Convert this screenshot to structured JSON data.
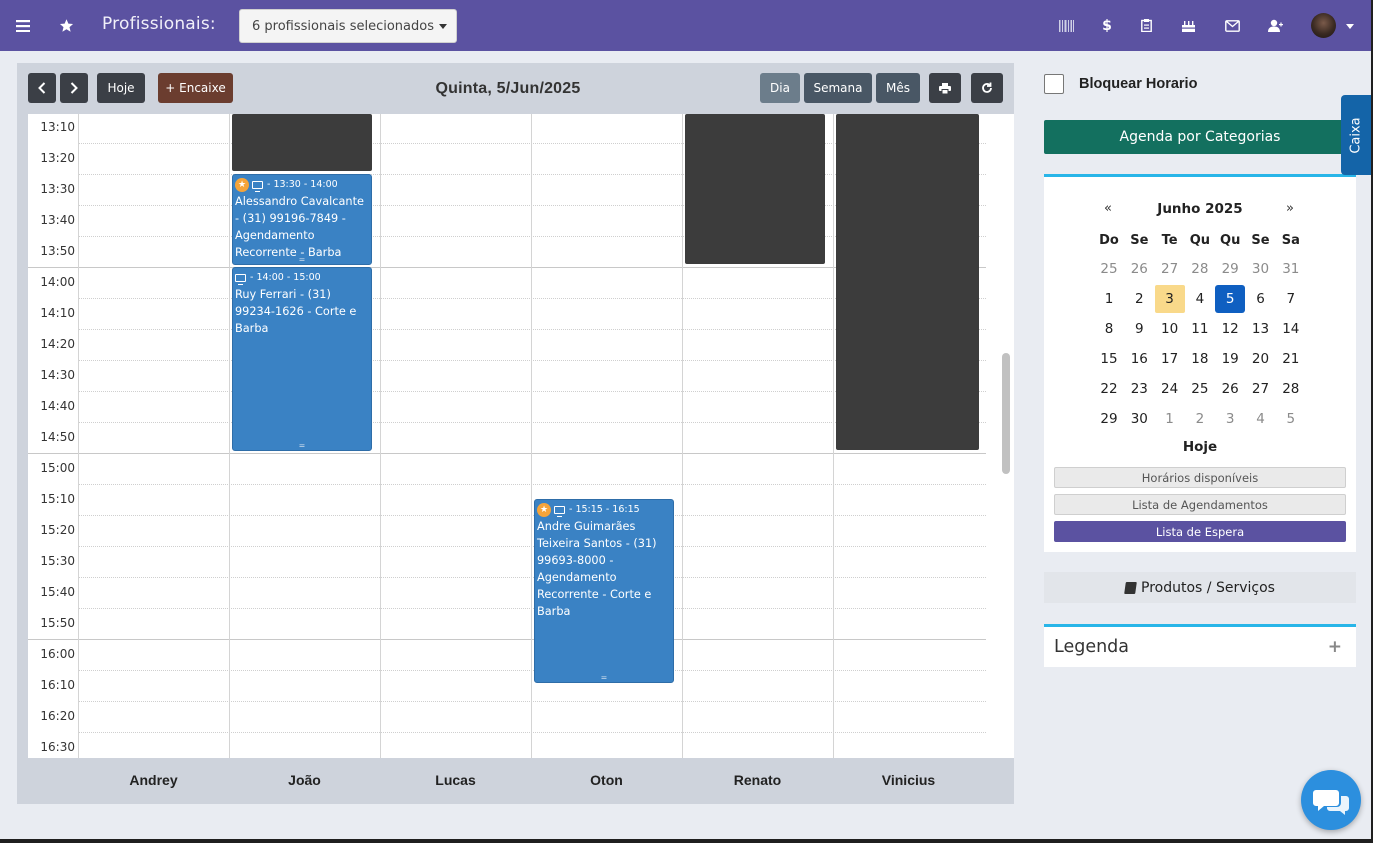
{
  "topbar": {
    "menu_icon": "hamburger-icon",
    "fav_icon": "star-icon",
    "prof_label": "Profissionais:",
    "prof_select": "6 profissionais selecionados",
    "icons": [
      "barcode-icon",
      "dollar-icon",
      "clipboard-icon",
      "cake-icon",
      "mail-icon",
      "user-plus-icon"
    ],
    "bg_color": "#5b52a1"
  },
  "toolbar": {
    "prev_icon": "chevron-left-icon",
    "next_icon": "chevron-right-icon",
    "hoje": "Hoje",
    "encaixe": "+ Encaixe",
    "date_title": "Quinta, 5/Jun/2025",
    "view_day": "Dia",
    "view_week": "Semana",
    "view_month": "Mês",
    "print_icon": "print-icon",
    "refresh_icon": "refresh-icon"
  },
  "times": [
    "13:10",
    "13:20",
    "13:30",
    "13:40",
    "13:50",
    "14:00",
    "14:10",
    "14:20",
    "14:30",
    "14:40",
    "14:50",
    "15:00",
    "15:10",
    "15:20",
    "15:30",
    "15:40",
    "15:50",
    "16:00",
    "16:10",
    "16:20",
    "16:30"
  ],
  "professionals": [
    "Andrey",
    "João",
    "Lucas",
    "Oton",
    "Renato",
    "Vinicius"
  ],
  "events": [
    {
      "time": "- 13:30 - 14:00",
      "text": "Alessandro Cavalcante - (31) 99196-7849 - Agendamento Recorrente - Barba",
      "star": true,
      "color": "#3a82c4"
    },
    {
      "time": "- 14:00 - 15:00",
      "text": "Ruy Ferrari - (31) 99234-1626 - Corte e Barba",
      "star": false,
      "color": "#3a82c4"
    },
    {
      "time": "- 15:15 - 16:15",
      "text": "Andre Guimarães Teixeira Santos - (31) 99693-8000 - Agendamento Recorrente - Corte e Barba",
      "star": true,
      "color": "#3a82c4"
    }
  ],
  "sidebar": {
    "bloquear": "Bloquear Horario",
    "agenda_categorias": "Agenda por Categorias",
    "caixa": "Caixa",
    "calendar": {
      "prev": "«",
      "next": "»",
      "title": "Junho 2025",
      "weekdays": [
        "Do",
        "Se",
        "Te",
        "Qu",
        "Qu",
        "Se",
        "Sa"
      ],
      "weeks": [
        [
          "25",
          "26",
          "27",
          "28",
          "29",
          "30",
          "31"
        ],
        [
          "1",
          "2",
          "3",
          "4",
          "5",
          "6",
          "7"
        ],
        [
          "8",
          "9",
          "10",
          "11",
          "12",
          "13",
          "14"
        ],
        [
          "15",
          "16",
          "17",
          "18",
          "19",
          "20",
          "21"
        ],
        [
          "22",
          "23",
          "24",
          "25",
          "26",
          "27",
          "28"
        ],
        [
          "29",
          "30",
          "1",
          "2",
          "3",
          "4",
          "5"
        ]
      ],
      "today": "3",
      "selected": "5",
      "hoje": "Hoje"
    },
    "horarios": "Horários disponíveis",
    "lista_agendamentos": "Lista de Agendamentos",
    "lista_espera": "Lista de Espera",
    "produtos": "Produtos / Serviços",
    "legenda": "Legenda",
    "legenda_toggle": "+"
  },
  "chat_icon": "chat-bubbles-icon"
}
